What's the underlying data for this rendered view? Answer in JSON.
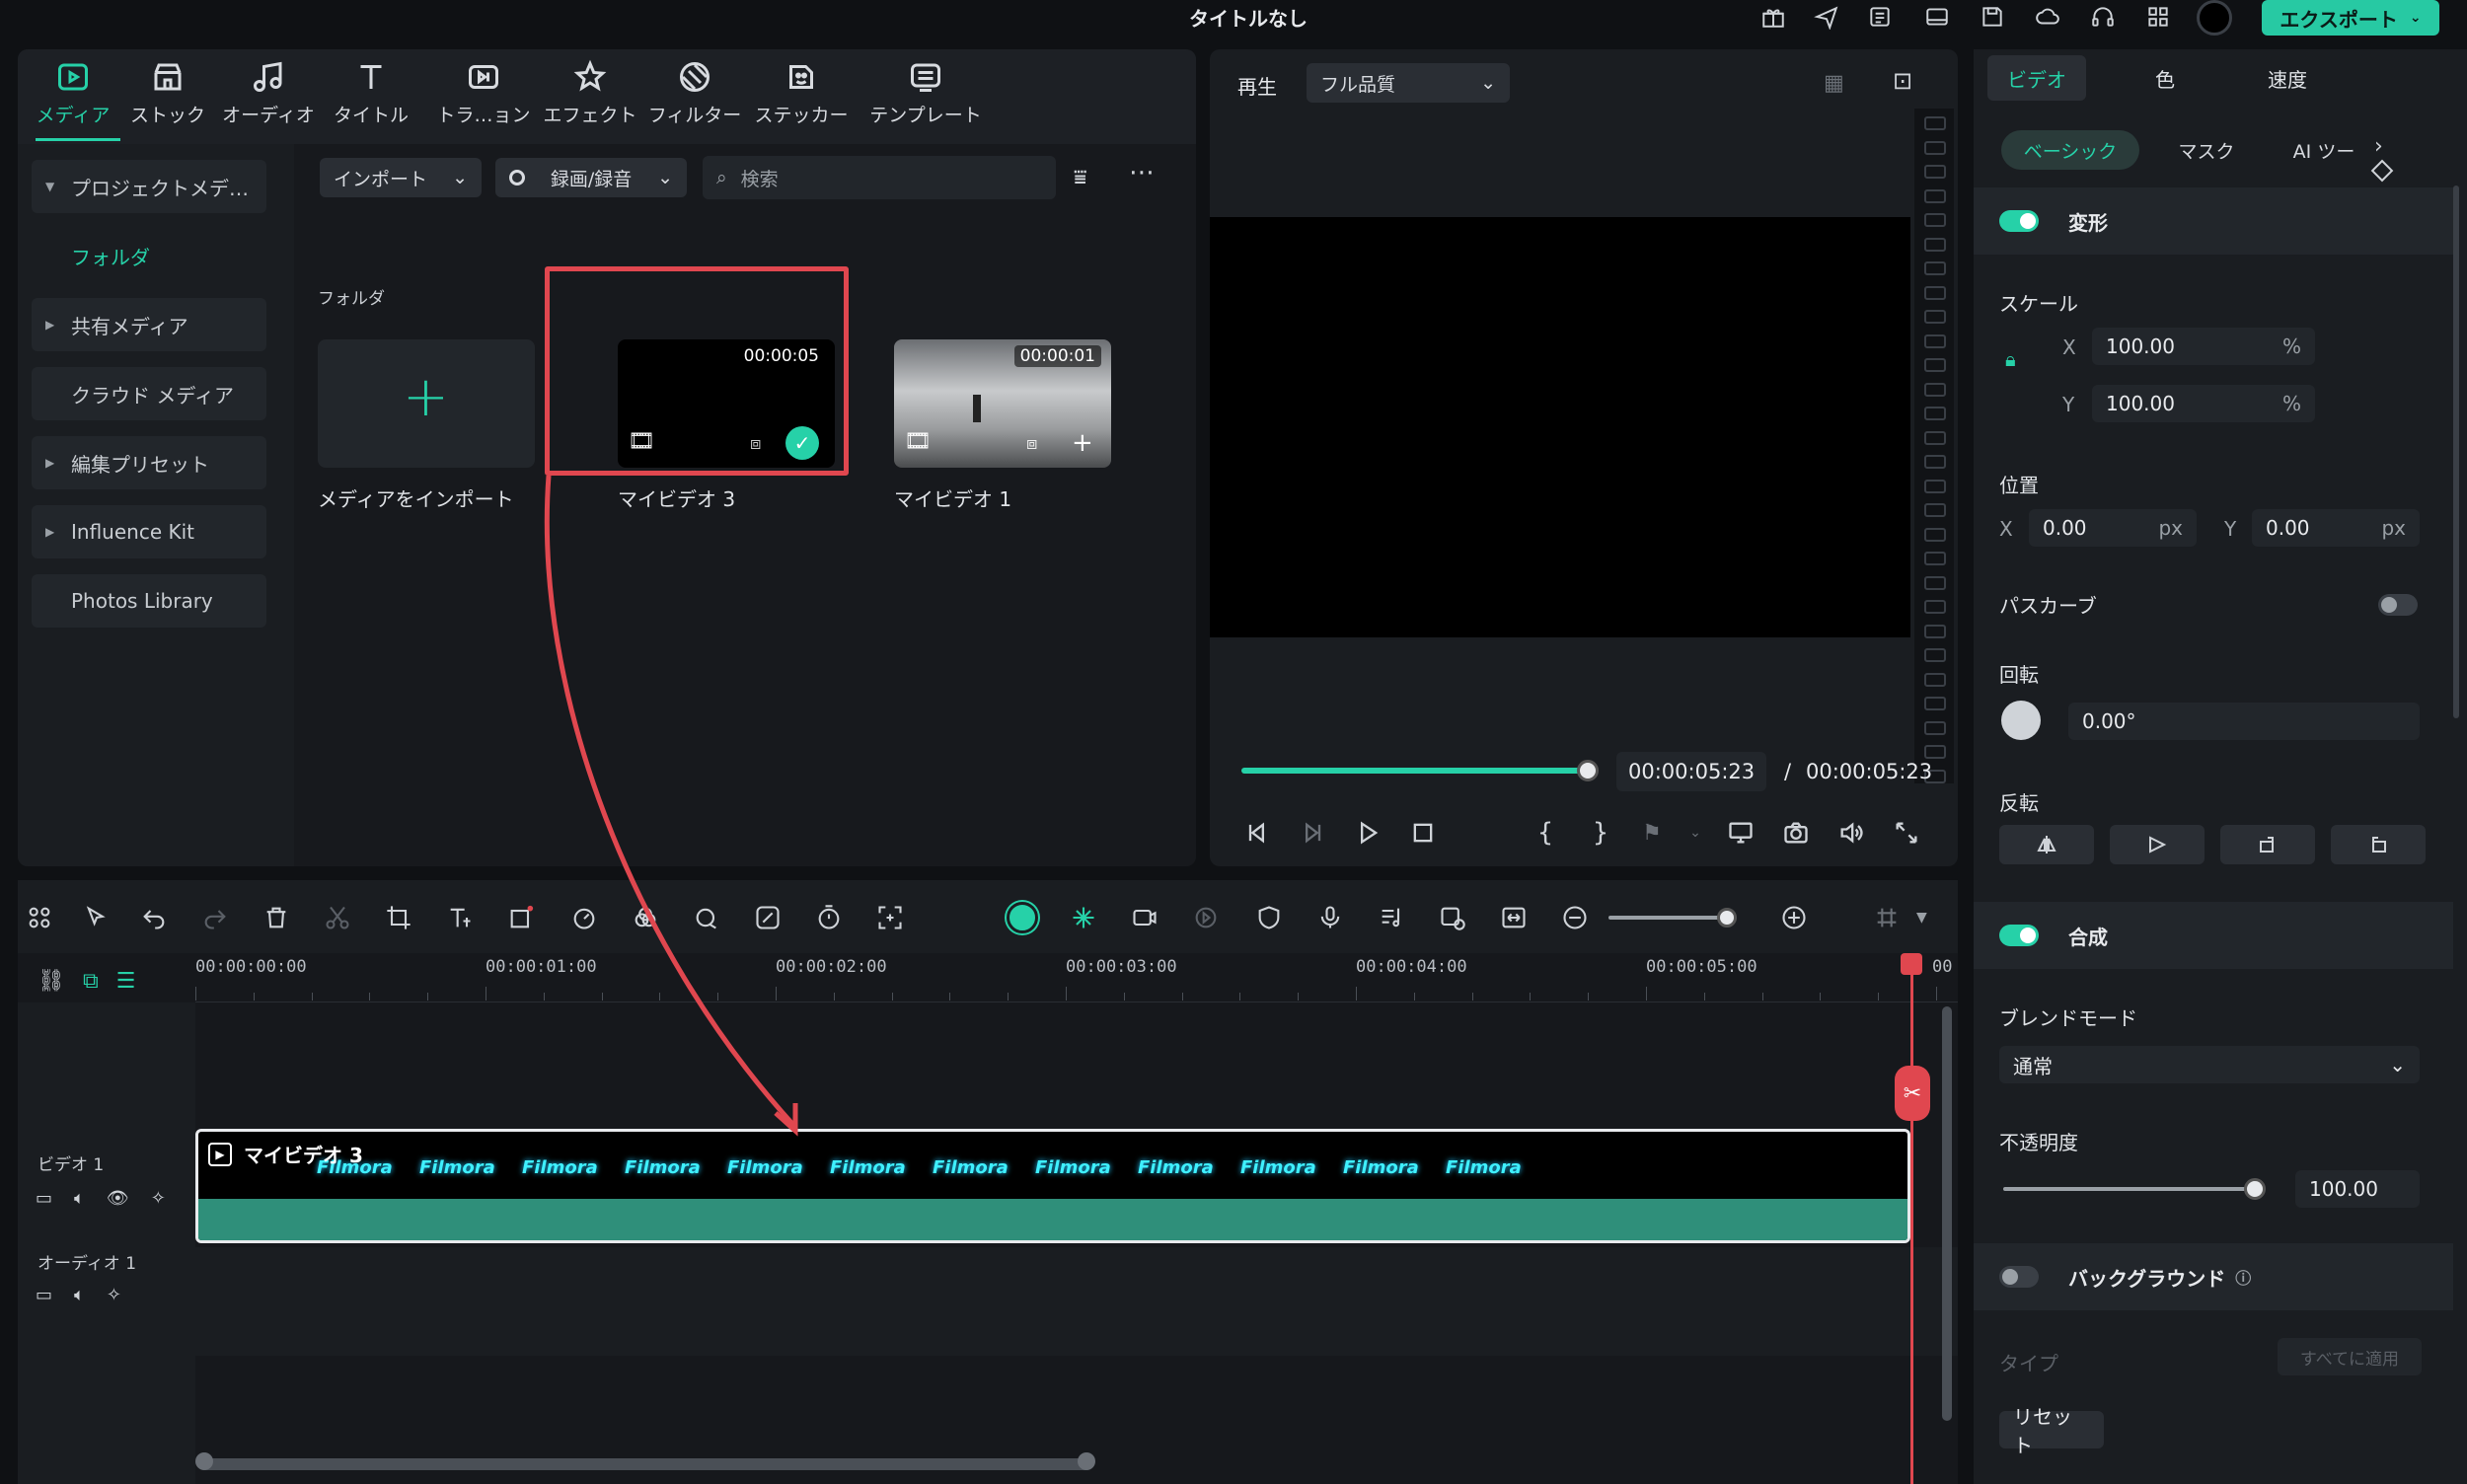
{
  "window": {
    "title": "タイトルなし",
    "export_label": "エクスポート"
  },
  "media_tabs": [
    {
      "label": "メディア",
      "icon": "media-icon"
    },
    {
      "label": "ストック",
      "icon": "store-icon"
    },
    {
      "label": "オーディオ",
      "icon": "music-icon"
    },
    {
      "label": "タイトル",
      "icon": "text-icon"
    },
    {
      "label": "トラ…ョン",
      "icon": "transition-icon"
    },
    {
      "label": "エフェクト",
      "icon": "effect-icon"
    },
    {
      "label": "フィルター",
      "icon": "filter-icon"
    },
    {
      "label": "ステッカー",
      "icon": "sticker-icon"
    },
    {
      "label": "テンプレート",
      "icon": "template-icon"
    }
  ],
  "sidebar": {
    "items": [
      {
        "label": "プロジェクトメデ…"
      },
      {
        "label": "フォルダ"
      },
      {
        "label": "共有メディア"
      },
      {
        "label": "クラウド メディア"
      },
      {
        "label": "編集プリセット"
      },
      {
        "label": "Influence Kit"
      },
      {
        "label": "Photos Library"
      }
    ]
  },
  "toolbar": {
    "import_label": "インポート",
    "record_label": "録画/録音",
    "search_placeholder": "検索"
  },
  "library": {
    "folder_label": "フォルダ",
    "import_card_label": "メディアをインポート",
    "items": [
      {
        "name": "マイビデオ 3",
        "duration": "00:00:05"
      },
      {
        "name": "マイビデオ 1",
        "duration": "00:00:01"
      }
    ]
  },
  "preview": {
    "play_label": "再生",
    "quality": "フル品質",
    "current_time": "00:00:05:23",
    "separator": "/",
    "total_time": "00:00:05:23",
    "progress": 1.0
  },
  "properties": {
    "tabs": [
      "ビデオ",
      "色",
      "速度"
    ],
    "subtabs": [
      "ベーシック",
      "マスク",
      "AI ツー"
    ],
    "transform_label": "変形",
    "scale_label": "スケール",
    "scale_x_label": "X",
    "scale_x": "100.00",
    "scale_y_label": "Y",
    "scale_y": "100.00",
    "percent": "%",
    "position_label": "位置",
    "pos_x_label": "X",
    "pos_x": "0.00",
    "pos_y_label": "Y",
    "pos_y": "0.00",
    "px": "px",
    "path_curve_label": "パスカーブ",
    "rotation_label": "回転",
    "rotation": "0.00°",
    "flip_label": "反転",
    "composite_label": "合成",
    "blend_mode_label": "ブレンドモード",
    "blend_mode": "通常",
    "opacity_label": "不透明度",
    "opacity": "100.00",
    "opacity_level": 1.0,
    "background_label": "バックグラウンド",
    "type_label": "タイプ",
    "apply_all_label": "すべてに適用",
    "reset_label": "リセット"
  },
  "timeline": {
    "ruler": [
      "00:00:00:00",
      "00:00:01:00",
      "00:00:02:00",
      "00:00:03:00",
      "00:00:04:00",
      "00:00:05:00",
      "00"
    ],
    "video_track": "ビデオ 1",
    "audio_track": "オーディオ 1",
    "clip_name": "マイビデオ 3",
    "clip_logo": "Filmora",
    "add_track": "+"
  },
  "colors": {
    "accent": "#26d1a8",
    "highlight": "#e0474f",
    "background": "#0f1114",
    "panel": "#1a1d21"
  }
}
